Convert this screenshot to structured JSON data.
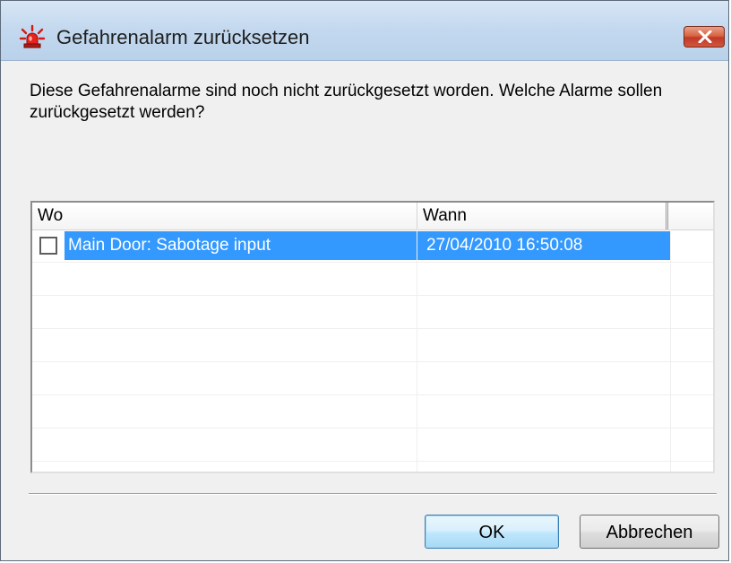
{
  "window": {
    "title": "Gefahrenalarm zurücksetzen",
    "icon": "alarm-beacon-icon",
    "close_icon": "close-icon"
  },
  "message": "Diese Gefahrenalarme sind noch nicht zurückgesetzt worden. Welche Alarme sollen zurückgesetzt werden?",
  "table": {
    "columns": [
      "Wo",
      "Wann",
      ""
    ],
    "rows": [
      {
        "checked": false,
        "selected": true,
        "wo": "Main Door: Sabotage input",
        "wann": "27/04/2010  16:50:08"
      }
    ]
  },
  "buttons": {
    "ok_label": "OK",
    "cancel_label": "Abbrechen"
  },
  "colors": {
    "selection": "#3399ff",
    "close_button": "#c0392b",
    "alarm_icon": "#e0201b"
  }
}
